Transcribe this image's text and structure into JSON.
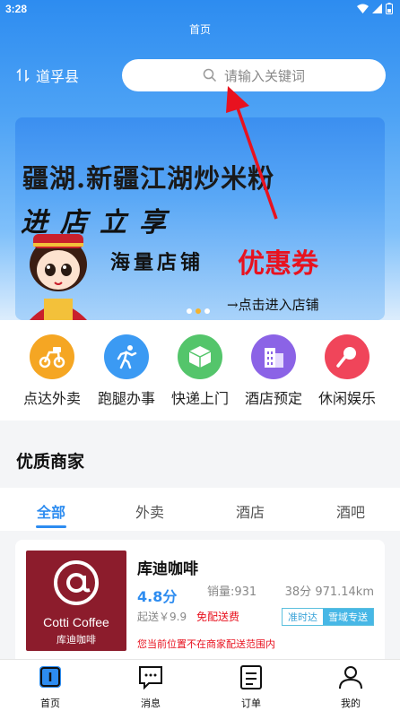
{
  "status": {
    "time": "3:28"
  },
  "page": {
    "title": "首页"
  },
  "location": {
    "city": "道孚县"
  },
  "search": {
    "placeholder": "请输入关键词"
  },
  "banner": {
    "line1": "疆湖.新疆江湖炒米粉",
    "line2": "进店立享",
    "line3": "海量店铺",
    "coupon": "优惠券",
    "enter": "→点击进入店铺",
    "dots": 3,
    "active_dot": 1
  },
  "categories": [
    {
      "label": "点达外卖",
      "icon": "scooter-icon",
      "color": "#f5a623"
    },
    {
      "label": "跑腿办事",
      "icon": "runner-icon",
      "color": "#3b9af3"
    },
    {
      "label": "快递上门",
      "icon": "package-icon",
      "color": "#54c56b"
    },
    {
      "label": "酒店预定",
      "icon": "hotel-icon",
      "color": "#8b63e6"
    },
    {
      "label": "休闲娱乐",
      "icon": "microphone-icon",
      "color": "#f0455a"
    }
  ],
  "section": {
    "title": "优质商家"
  },
  "tabs": [
    {
      "label": "全部",
      "active": true
    },
    {
      "label": "外卖",
      "active": false
    },
    {
      "label": "酒店",
      "active": false
    },
    {
      "label": "酒吧",
      "active": false
    }
  ],
  "merchant": {
    "logo_text": "Cotti Coffee",
    "logo_subtext": "库迪咖啡",
    "name": "库迪咖啡",
    "rating": "4.8分",
    "sales": "销量:931",
    "distance": "38分 971.14km",
    "min_order": "起送￥9.9",
    "free_delivery": "免配送费",
    "badge_on_time": "准时达",
    "badge_express": "雪域专送",
    "notice": "您当前位置不在商家配送范围内"
  },
  "bottom_nav": [
    {
      "label": "首页",
      "icon": "home-icon",
      "active": true
    },
    {
      "label": "消息",
      "icon": "message-icon",
      "active": false
    },
    {
      "label": "订单",
      "icon": "order-icon",
      "active": false
    },
    {
      "label": "我的",
      "icon": "profile-icon",
      "active": false
    }
  ],
  "colors": {
    "primary": "#2d8cf0",
    "danger": "#e8121f"
  }
}
